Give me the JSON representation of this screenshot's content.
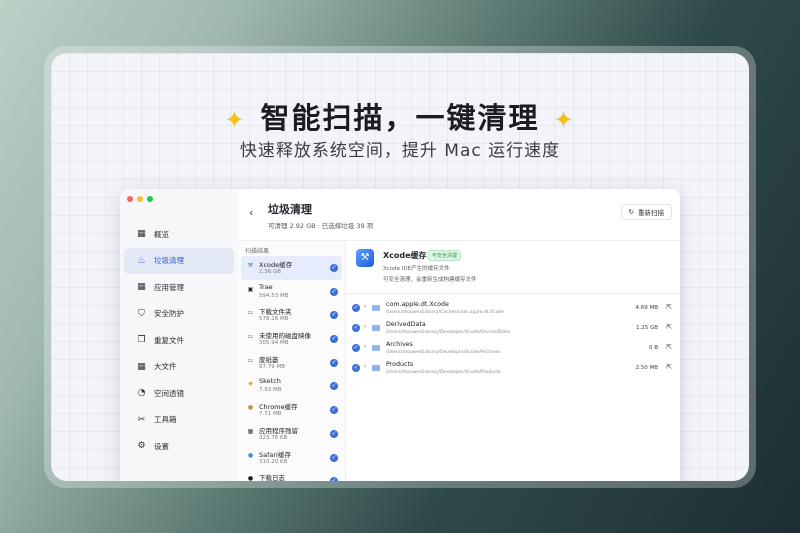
{
  "hero": {
    "spark_left": "✦",
    "spark_right": "✦",
    "title": "智能扫描，一键清理",
    "subtitle": "快速释放系统空间，提升 Mac 运行速度"
  },
  "sidebar": {
    "items": [
      {
        "label": "概览",
        "icon": "grid-icon",
        "glyph": "▦"
      },
      {
        "label": "垃圾清理",
        "icon": "broom-icon",
        "glyph": "♨"
      },
      {
        "label": "应用管理",
        "icon": "apps-icon",
        "glyph": "▦"
      },
      {
        "label": "安全防护",
        "icon": "shield-icon",
        "glyph": "⛉"
      },
      {
        "label": "重复文件",
        "icon": "duplicate-icon",
        "glyph": "❐"
      },
      {
        "label": "大文件",
        "icon": "large-file-icon",
        "glyph": "▦"
      },
      {
        "label": "空间透镜",
        "icon": "pie-icon",
        "glyph": "◔"
      },
      {
        "label": "工具箱",
        "icon": "tools-icon",
        "glyph": "✂"
      },
      {
        "label": "设置",
        "icon": "gear-icon",
        "glyph": "⚙"
      }
    ]
  },
  "header": {
    "back": "‹",
    "title": "垃圾清理",
    "summary": "可清理 2.92 GB · 已选择垃圾 39 项",
    "rescan_icon": "↻",
    "rescan_label": "重新扫描"
  },
  "results": {
    "heading": "扫描结果",
    "items": [
      {
        "name": "Xcode缓存",
        "size": "1.36 GB",
        "glyph": "⚒",
        "color": "#2f6fe0"
      },
      {
        "name": "Trae",
        "size": "594.53 MB",
        "glyph": "▣",
        "color": "#1f2a24"
      },
      {
        "name": "下载文件夹",
        "size": "578.16 MB",
        "glyph": "▭",
        "color": "#3a3d44"
      },
      {
        "name": "未使用的磁盘映像",
        "size": "305.94 MB",
        "glyph": "▭",
        "color": "#3a3d44"
      },
      {
        "name": "废纸篓",
        "size": "87.79 MB",
        "glyph": "▭",
        "color": "#3a3d44"
      },
      {
        "name": "Sketch",
        "size": "7.93 MB",
        "glyph": "◆",
        "color": "#f0a92a"
      },
      {
        "name": "Chrome缓存",
        "size": "7.71 MB",
        "glyph": "●",
        "color": "#c98a3c"
      },
      {
        "name": "应用程序残留",
        "size": "323.76 KB",
        "glyph": "▦",
        "color": "#3a3d44"
      },
      {
        "name": "Safari缓存",
        "size": "310.20 KB",
        "glyph": "●",
        "color": "#3b8de6"
      },
      {
        "name": "下载日志",
        "size": "",
        "glyph": "●",
        "color": "#1b1c22"
      }
    ]
  },
  "detail": {
    "title": "Xcode缓存",
    "badge": "可安全清理",
    "description": "Xcode IDE产生的缓存文件",
    "note": "可安全清理，会重新生成构建缓存文件",
    "entries": [
      {
        "name": "com.apple.dt.Xcode",
        "path": "/Users/zhouwei/Library/Caches/com.apple.dt.Xcode",
        "size": "4.69 MB"
      },
      {
        "name": "DerivedData",
        "path": "/Users/zhouwei/Library/Developer/Xcode/DerivedData",
        "size": "1.25 GB"
      },
      {
        "name": "Archives",
        "path": "/Users/zhouwei/Library/Developer/Xcode/Archives",
        "size": "0 B"
      },
      {
        "name": "Products",
        "path": "/Users/zhouwei/Library/Developer/Xcode/Products",
        "size": "2.50 MB"
      }
    ]
  },
  "colors": {
    "accent": "#3b6fe0",
    "traffic": [
      "#ff5f57",
      "#febc2e",
      "#28c840"
    ],
    "spark": "#f1c21b"
  }
}
